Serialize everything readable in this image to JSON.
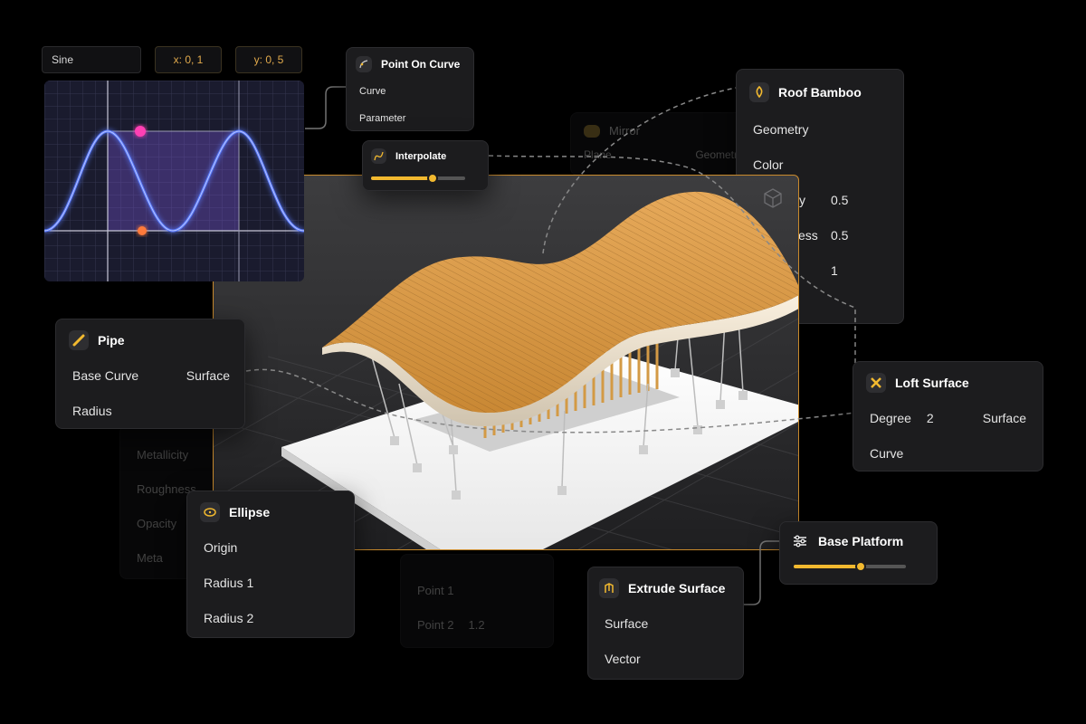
{
  "chart_panel": {
    "function_label": "Sine",
    "x_chip": "x: 0, 1",
    "y_chip": "y: 0, 5"
  },
  "nodes": {
    "point_on_curve": {
      "title": "Point On Curve",
      "inputs": [
        "Curve",
        "Parameter"
      ]
    },
    "interpolate": {
      "title": "Interpolate",
      "slider_value": 0.65
    },
    "mirror": {
      "title": "Mirror",
      "row_left": "Plane",
      "row_right": "Geometr"
    },
    "roof_bamboo": {
      "title": "Roof Bamboo",
      "inputs": [
        "Geometry",
        "Color"
      ],
      "rows": [
        {
          "label": "ity",
          "value": "0.5"
        },
        {
          "label": "ess",
          "value": "0.5"
        },
        {
          "label": "",
          "value": "1"
        }
      ]
    },
    "pipe": {
      "title": "Pipe",
      "input_1": "Base Curve",
      "output_1": "Surface",
      "input_2": "Radius"
    },
    "material_ghost": {
      "rows": [
        "Metallicity",
        "Roughness",
        "Opacity",
        "Meta"
      ]
    },
    "ellipse": {
      "title": "Ellipse",
      "inputs": [
        "Origin",
        "Radius 1",
        "Radius 2"
      ]
    },
    "points_ghost": {
      "row_1": "Point 1",
      "row_2": "Point 2",
      "row_2_value": "1.2"
    },
    "loft_surface": {
      "title": "Loft Surface",
      "input_1": "Degree",
      "input_1_value": "2",
      "output_1": "Surface",
      "input_2": "Curve"
    },
    "base_platform": {
      "title": "Base Platform",
      "slider_value": 0.6
    },
    "extrude_surface": {
      "title": "Extrude Surface",
      "inputs": [
        "Surface",
        "Vector"
      ]
    }
  },
  "colors": {
    "accent": "#f2b92f",
    "port_blue": "#3fa9f5",
    "port_green": "#b9e28c",
    "port_maroon": "#a8416a",
    "port_orange": "#f0a050",
    "node_bg": "#1c1c1e",
    "wave": "#5a7bff"
  },
  "icons": {
    "point_on_curve": "curve-point-icon",
    "interpolate": "interpolate-icon",
    "mirror": "mirror-icon",
    "roof_bamboo": "bamboo-icon",
    "pipe": "pipe-icon",
    "ellipse": "ellipse-icon",
    "loft_surface": "loft-icon",
    "base_platform": "sliders-icon",
    "extrude_surface": "extrude-icon",
    "viewport": "cube-icon"
  }
}
